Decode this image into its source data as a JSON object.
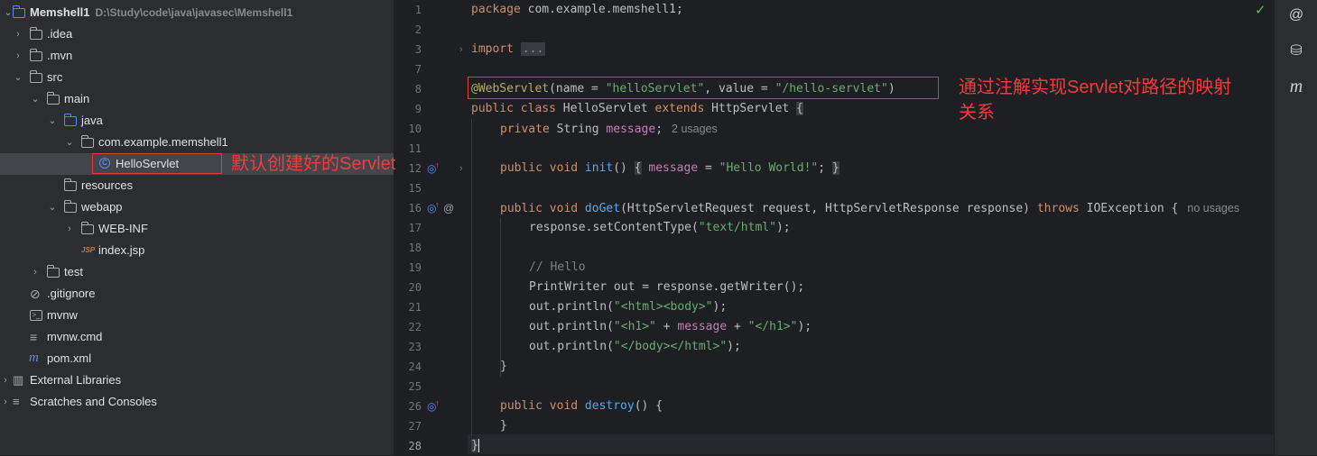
{
  "project": {
    "root_name": "Memshell1",
    "root_path": "D:\\Study\\code\\java\\javasec\\Memshell1",
    "items": [
      {
        "label": ".idea",
        "icon": "folder-icon"
      },
      {
        "label": ".mvn",
        "icon": "folder-icon"
      },
      {
        "label": "src",
        "icon": "folder-icon"
      },
      {
        "label": "main",
        "icon": "folder-icon"
      },
      {
        "label": "java",
        "icon": "source-folder-icon"
      },
      {
        "label": "com.example.memshell1",
        "icon": "package-icon"
      },
      {
        "label": "HelloServlet",
        "icon": "class-icon"
      },
      {
        "label": "resources",
        "icon": "resources-folder-icon"
      },
      {
        "label": "webapp",
        "icon": "web-folder-icon"
      },
      {
        "label": "WEB-INF",
        "icon": "folder-icon"
      },
      {
        "label": "index.jsp",
        "icon": "jsp-file-icon"
      },
      {
        "label": "test",
        "icon": "folder-icon"
      },
      {
        "label": ".gitignore",
        "icon": "gitignore-icon"
      },
      {
        "label": "mvnw",
        "icon": "terminal-file-icon"
      },
      {
        "label": "mvnw.cmd",
        "icon": "text-file-icon"
      },
      {
        "label": "pom.xml",
        "icon": "maven-icon"
      },
      {
        "label": "External Libraries",
        "icon": "libraries-icon"
      },
      {
        "label": "Scratches and Consoles",
        "icon": "scratches-icon"
      }
    ]
  },
  "editor": {
    "line_numbers": [
      "1",
      "2",
      "3",
      "7",
      "8",
      "9",
      "10",
      "11",
      "12",
      "15",
      "16",
      "17",
      "18",
      "19",
      "20",
      "21",
      "22",
      "23",
      "24",
      "25",
      "26",
      "27",
      "28"
    ],
    "code": {
      "l1_kw": "package",
      "l1_rest": " com.example.memshell1;",
      "l3_kw": "import",
      "l3_collapsed": "...",
      "l8_ann": "@WebServlet",
      "l8_a": "(name = ",
      "l8_s1": "\"helloServlet\"",
      "l8_b": ", value = ",
      "l8_s2": "\"/hello-servlet\"",
      "l8_c": ")",
      "l9_kw1": "public class",
      "l9_mid": " HelloServlet ",
      "l9_kw2": "extends",
      "l9_rest": " HttpServlet ",
      "l9_brace": "{",
      "l10_kw": "private",
      "l10_type": " String ",
      "l10_fld": "message",
      "l10_semi": ";",
      "l10_hint": "2 usages",
      "l12_kw": "public void",
      "l12_fn": "init",
      "l12_paren": "()",
      "l12_ob": "{",
      "l12_fld": "message",
      "l12_eq": " = ",
      "l12_str": "\"Hello World!\"",
      "l12_semi": ";",
      "l12_cb": "}",
      "l16_kw": "public void",
      "l16_fn": "doGet",
      "l16_params": "(HttpServletRequest request, HttpServletResponse response) ",
      "l16_throws": "throws",
      "l16_rest": " IOException {",
      "l16_hint": "no usages",
      "l17_a": "response.setContentType(",
      "l17_str": "\"text/html\"",
      "l17_b": ");",
      "l19_cm": "// Hello",
      "l20": "PrintWriter out = response.getWriter();",
      "l21_a": "out.println(",
      "l21_str": "\"<html><body>\"",
      "l21_b": ");",
      "l22_a": "out.println(",
      "l22_s1": "\"<h1>\"",
      "l22_plus1": " + ",
      "l22_fld": "message",
      "l22_plus2": " + ",
      "l22_s2": "\"</h1>\"",
      "l22_b": ");",
      "l23_a": "out.println(",
      "l23_str": "\"</body></html>\"",
      "l23_b": ");",
      "l24": "}",
      "l26_kw": "public void",
      "l26_fn": "destroy",
      "l26_rest": "() {",
      "l27": "}",
      "l28": "}"
    }
  },
  "annotations": {
    "default_servlet": "默认创建好的Servlet",
    "mapping_line1": "通过注解实现Servlet对路径的映射",
    "mapping_line2": "关系"
  },
  "colors": {
    "annotation_red": "#ef3d3d",
    "keyword": "#cf8e6d",
    "string": "#6aab73",
    "annotation": "#b3ae60",
    "field": "#c77dbb",
    "function": "#56a8f5"
  }
}
